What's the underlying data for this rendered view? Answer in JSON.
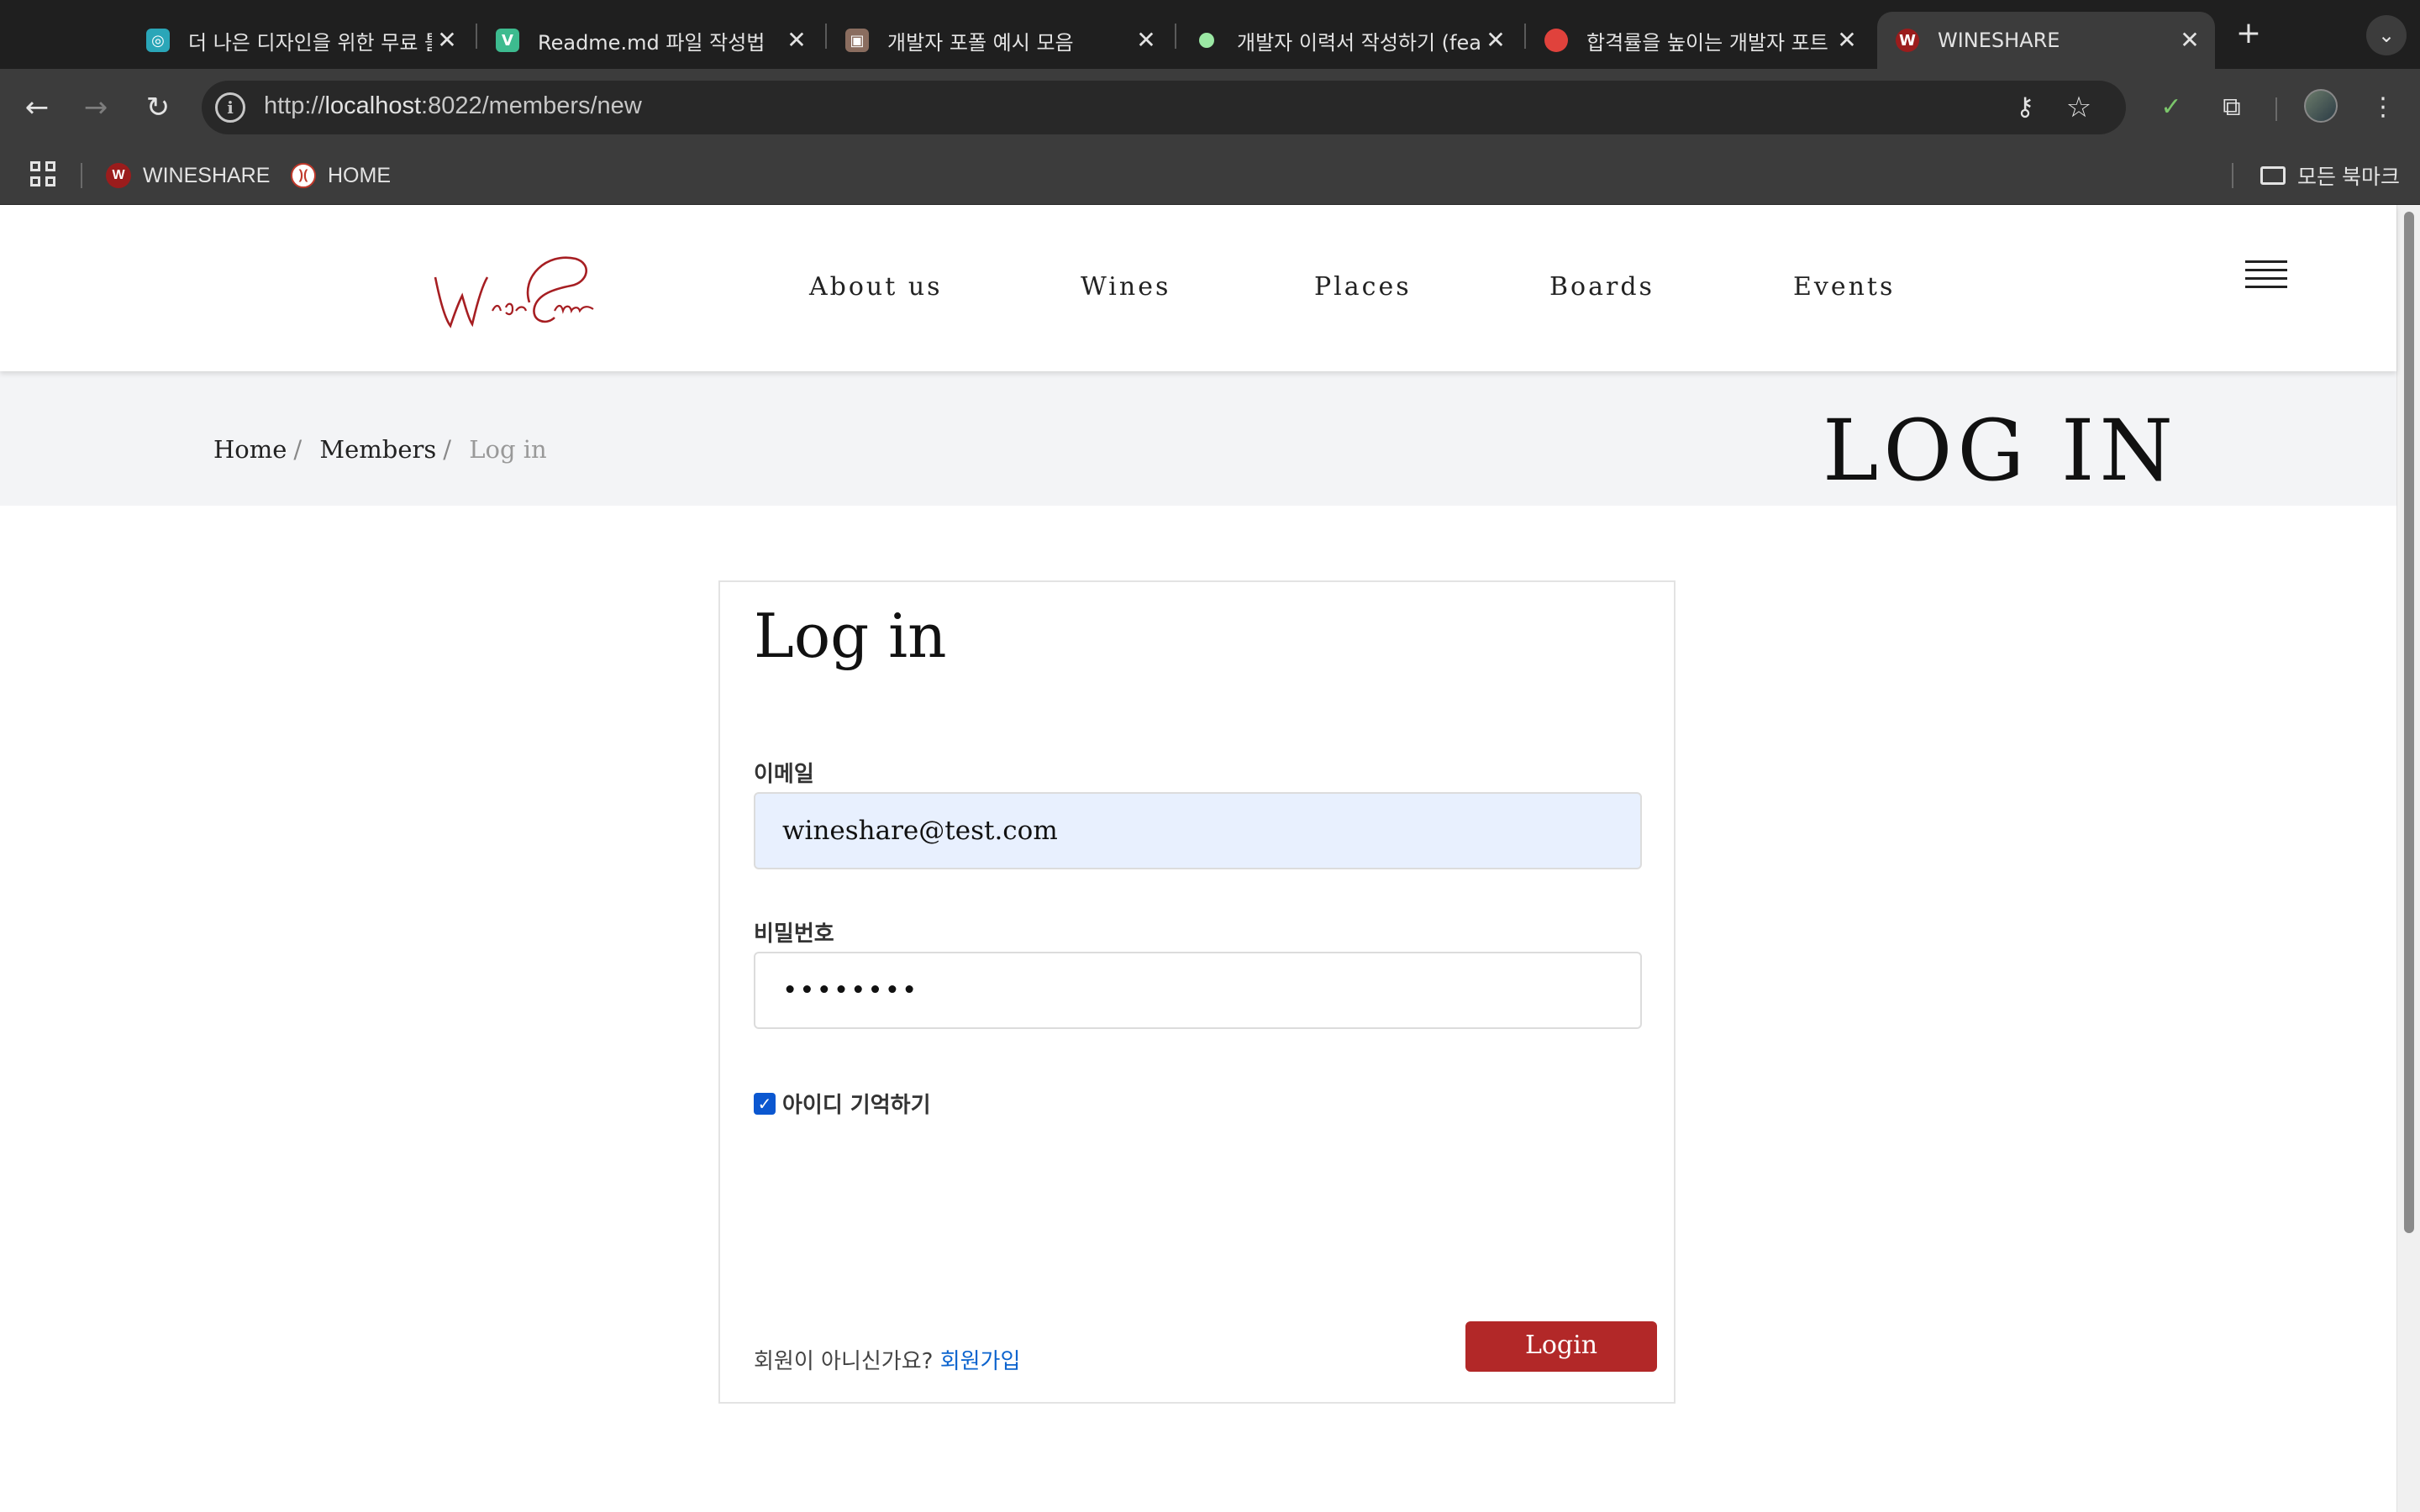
{
  "browser": {
    "tabs": [
      {
        "title": "더 나은 디자인을 위한 무료 툴",
        "favicon": "swirl-icon",
        "color": "#2aa6b8",
        "active": false
      },
      {
        "title": "Readme.md 파일 작성법",
        "favicon": "v-icon",
        "color": "#3dbb8f",
        "active": false
      },
      {
        "title": "개발자 포폴 예시 모음",
        "favicon": "image-icon",
        "color": "#8a6d5f",
        "active": false
      },
      {
        "title": "개발자 이력서 작성하기 (fea",
        "favicon": "dot-icon",
        "color": "#9be8a4",
        "active": false
      },
      {
        "title": "합격률을 높이는 개발자 포트",
        "favicon": "ball-icon",
        "color": "#e0423c",
        "active": false
      },
      {
        "title": "WINESHARE",
        "favicon": "w-icon",
        "color": "#9b1c1c",
        "active": true
      }
    ],
    "address": {
      "prefix": "http://",
      "host": "localhost",
      "rest": ":8022/members/new"
    },
    "bookmarks": [
      {
        "label": "WINESHARE",
        "favicon": "w-icon"
      },
      {
        "label": "HOME",
        "favicon": "baseball-icon"
      }
    ],
    "all_bookmarks_label": "모든 북마크"
  },
  "site": {
    "logo_text": "Wine Share",
    "nav": [
      "About us",
      "Wines",
      "Places",
      "Boards",
      "Events"
    ],
    "breadcrumb": {
      "home": "Home",
      "members": "Members",
      "current": "Log in"
    },
    "page_heading": "LOG IN"
  },
  "login": {
    "title": "Log in",
    "email_label": "이메일",
    "email_value": "wineshare@test.com",
    "password_label": "비밀번호",
    "password_mask": "••••••••",
    "remember_label": "아이디 기억하기",
    "remember_checked": true,
    "signup_prompt": "회원이 아니신가요?",
    "signup_link": "회원가입",
    "submit_label": "Login"
  },
  "colors": {
    "brand": "#b22828",
    "link": "#0b63ce",
    "autofill": "#e8f0fe"
  }
}
